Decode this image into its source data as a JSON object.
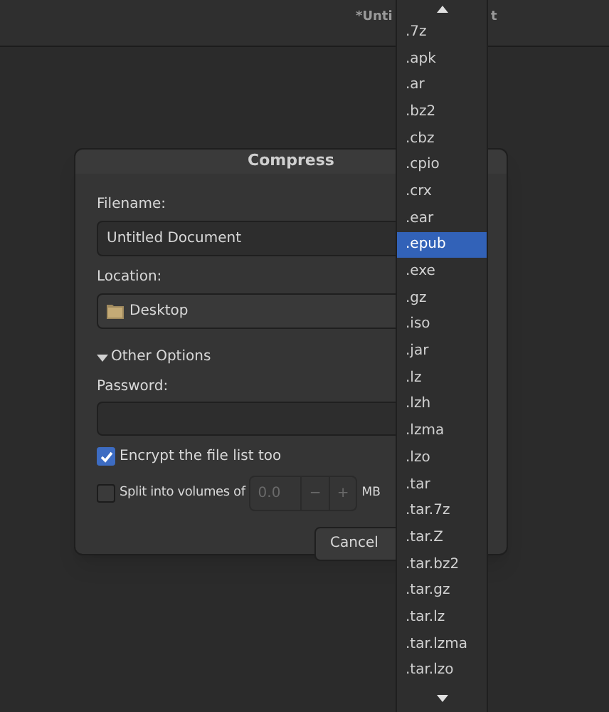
{
  "window": {
    "title_parts": [
      "*Unti",
      "t"
    ]
  },
  "dialog": {
    "title": "Compress",
    "filename_label": "Filename:",
    "filename": "Untitled Document",
    "location_label": "Location:",
    "location": "Desktop",
    "other_options": {
      "label": "Other Options",
      "expanded": true
    },
    "password_label": "Password:",
    "encrypt": {
      "label": "Encrypt the file list too",
      "checked": true
    },
    "split": {
      "label": "Split into volumes of",
      "checked": false,
      "value": "0.0",
      "minus": "−",
      "plus": "+",
      "unit": "MB"
    },
    "buttons": [
      "Cancel"
    ]
  },
  "dropdown": {
    "items": [
      {
        "label": ".7z",
        "selected": false
      },
      {
        "label": ".apk",
        "selected": false
      },
      {
        "label": ".ar",
        "selected": false
      },
      {
        "label": ".bz2",
        "selected": false
      },
      {
        "label": ".cbz",
        "selected": false
      },
      {
        "label": ".cpio",
        "selected": false
      },
      {
        "label": ".crx",
        "selected": false
      },
      {
        "label": ".ear",
        "selected": false
      },
      {
        "label": ".epub",
        "selected": true
      },
      {
        "label": ".exe",
        "selected": false
      },
      {
        "label": ".gz",
        "selected": false
      },
      {
        "label": ".iso",
        "selected": false
      },
      {
        "label": ".jar",
        "selected": false
      },
      {
        "label": ".lz",
        "selected": false
      },
      {
        "label": ".lzh",
        "selected": false
      },
      {
        "label": ".lzma",
        "selected": false
      },
      {
        "label": ".lzo",
        "selected": false
      },
      {
        "label": ".tar",
        "selected": false
      },
      {
        "label": ".tar.7z",
        "selected": false
      },
      {
        "label": ".tar.Z",
        "selected": false
      },
      {
        "label": ".tar.bz2",
        "selected": false
      },
      {
        "label": ".tar.gz",
        "selected": false
      },
      {
        "label": ".tar.lz",
        "selected": false
      },
      {
        "label": ".tar.lzma",
        "selected": false
      },
      {
        "label": ".tar.lzo",
        "selected": false
      }
    ]
  }
}
